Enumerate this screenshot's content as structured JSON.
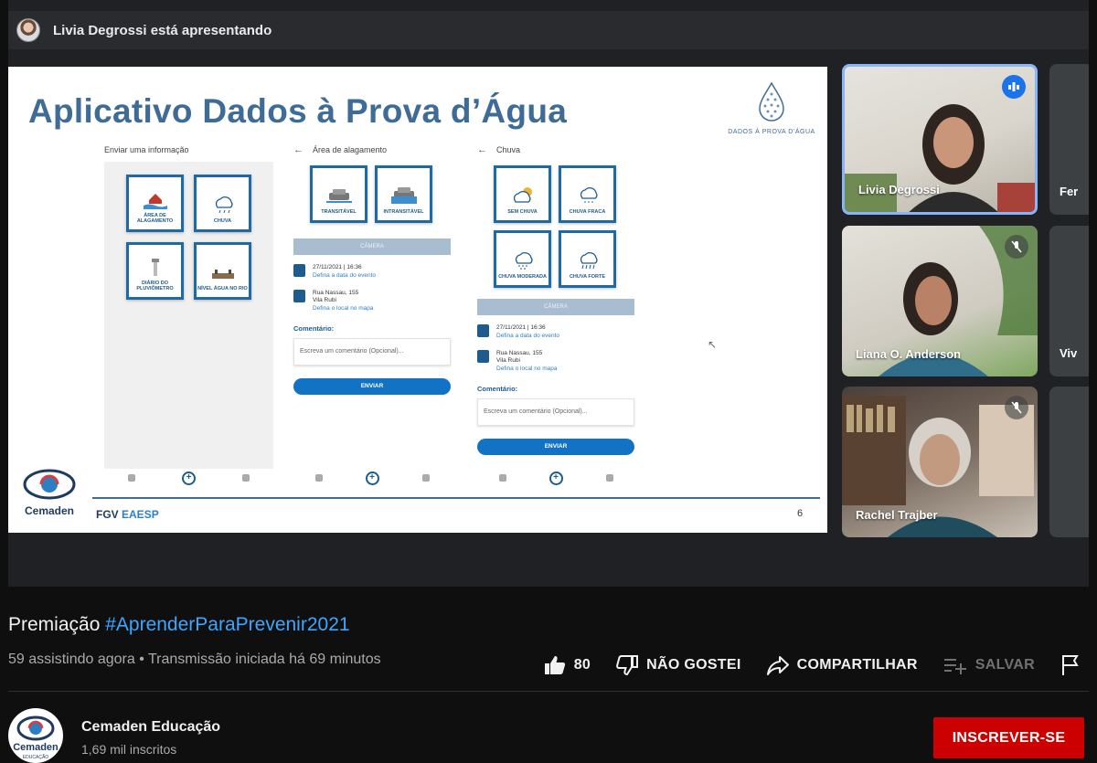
{
  "meet": {
    "presenting_banner": "Livia Degrossi está apresentando"
  },
  "slide": {
    "title": "Aplicativo Dados à Prova d’Água",
    "logo_caption": "DADOS À PROVA D’ÁGUA",
    "page_number": "6",
    "footer_left": "Cemaden",
    "footer_fgv": "FGV",
    "footer_eaesp": "EAESP",
    "panel1": {
      "heading": "Enviar uma informação",
      "tiles": [
        "ÁREA DE ALAGAMENTO",
        "CHUVA",
        "DIÁRIO DO PLUVIÔMETRO",
        "NÍVEL ÁGUA NO RIO"
      ]
    },
    "panel2": {
      "heading": "Área de alagamento",
      "tiles": [
        "TRANSITÁVEL",
        "INTRANSITÁVEL"
      ],
      "camera": "CÂMERA",
      "date": "27/11/2021  |  16:36",
      "date_link": "Defina a data do evento",
      "address1": "Rua Nassau, 155",
      "address2": "Vila Rubi",
      "address_link": "Defina o local no mapa",
      "comment_label": "Comentário:",
      "comment_placeholder": "Escreva um comentário (Opcional)...",
      "send": "ENVIAR"
    },
    "panel3": {
      "heading": "Chuva",
      "tiles": [
        "SEM CHUVA",
        "CHUVA FRACA",
        "CHUVA MODERADA",
        "CHUVA FORTE"
      ],
      "camera": "CÂMERA",
      "date": "27/11/2021  |  16:36",
      "date_link": "Defina a data do evento",
      "address1": "Rua Nassau, 155",
      "address2": "Vila Rubi",
      "address_link": "Defina o local no mapa",
      "comment_label": "Comentário:",
      "comment_placeholder": "Escreva um comentário (Opcional)...",
      "send": "ENVIAR"
    }
  },
  "participants": [
    {
      "name": "Livia Degrossi",
      "status": "speaking"
    },
    {
      "name": "Liana O. Anderson",
      "status": "muted"
    },
    {
      "name": "Rachel Trajber",
      "status": "muted"
    }
  ],
  "side_participants": [
    "Fer",
    "Viv",
    ""
  ],
  "video": {
    "title_prefix": "Premiação ",
    "title_hashtag": "#AprenderParaPrevenir2021",
    "meta": "59 assistindo agora • Transmissão iniciada há 69 minutos",
    "likes": "80",
    "dislike_label": "NÃO GOSTEI",
    "share_label": "COMPARTILHAR",
    "save_label": "SALVAR"
  },
  "channel": {
    "name": "Cemaden Educação",
    "subscribers": "1,69 mil inscritos",
    "avatar_text": "Cemaden",
    "avatar_subtext": "EDUCAÇÃO",
    "subscribe_label": "INSCREVER-SE"
  },
  "colors": {
    "slide_title": "#3f6c97",
    "hashtag": "#3ea6ff",
    "subscribe": "#cc0000",
    "meet_speaking": "#1a73e8"
  }
}
